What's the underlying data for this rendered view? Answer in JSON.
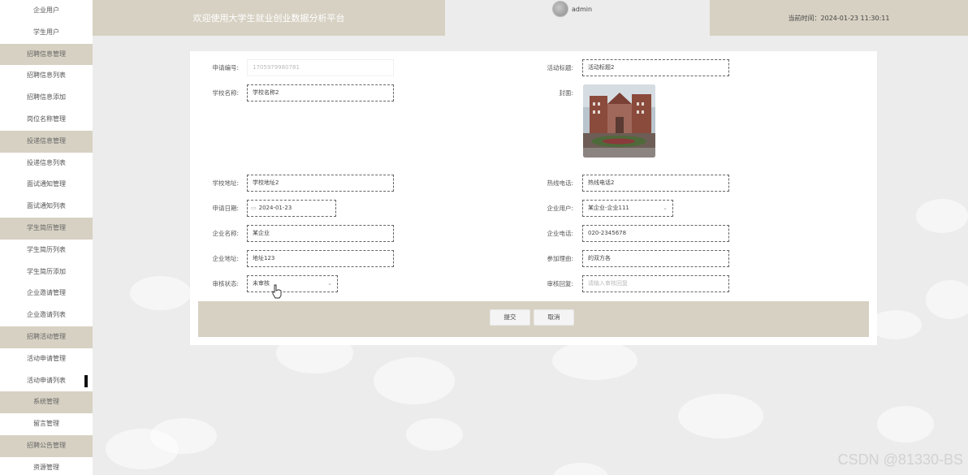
{
  "sidebar": {
    "items": [
      {
        "label": "企业用户",
        "group": false
      },
      {
        "label": "学生用户",
        "group": false
      },
      {
        "label": "招聘信息管理",
        "group": true
      },
      {
        "label": "招聘信息列表",
        "group": false
      },
      {
        "label": "招聘信息添加",
        "group": false
      },
      {
        "label": "岗位名称管理",
        "group": false
      },
      {
        "label": "投递信息管理",
        "group": true
      },
      {
        "label": "投递信息列表",
        "group": false
      },
      {
        "label": "面试通知管理",
        "group": false
      },
      {
        "label": "面试通知列表",
        "group": false
      },
      {
        "label": "学生简历管理",
        "group": true
      },
      {
        "label": "学生简历列表",
        "group": false
      },
      {
        "label": "学生简历添加",
        "group": false
      },
      {
        "label": "企业邀请管理",
        "group": false
      },
      {
        "label": "企业邀请列表",
        "group": false
      },
      {
        "label": "招聘活动管理",
        "group": true
      },
      {
        "label": "活动申请管理",
        "group": false
      },
      {
        "label": "活动申请列表",
        "group": false,
        "active": true
      },
      {
        "label": "系统管理",
        "group": true
      },
      {
        "label": "留言管理",
        "group": false
      },
      {
        "label": "招聘公告管理",
        "group": true
      },
      {
        "label": "资源管理",
        "group": false
      }
    ]
  },
  "header": {
    "welcome": "欢迎使用大学生就业创业数据分析平台",
    "username": "admin",
    "time_label": "当前时间：2024-01-23 11:30:11"
  },
  "form": {
    "apply_no": {
      "label": "申请编号:",
      "value": "1705979980781"
    },
    "activity_title": {
      "label": "活动标题:",
      "value": "活动标题2"
    },
    "school_name": {
      "label": "学校名称:",
      "value": "学校名称2"
    },
    "cover": {
      "label": "封面:"
    },
    "school_address": {
      "label": "学校地址:",
      "value": "学校地址2"
    },
    "contact_phone": {
      "label": "热线电话:",
      "value": "热线电话2"
    },
    "apply_date": {
      "label": "申请日期:",
      "value": "2024-01-23"
    },
    "company_user": {
      "label": "企业用户:",
      "value": "某企业-企业111"
    },
    "company_name": {
      "label": "企业名称:",
      "value": "某企业"
    },
    "company_phone": {
      "label": "企业电话:",
      "value": "020-2345678"
    },
    "company_address": {
      "label": "企业地址:",
      "value": "地址123"
    },
    "join_reason": {
      "label": "参加理由:",
      "value": "的双方各"
    },
    "review_status": {
      "label": "审核状态:",
      "value": "未审核"
    },
    "review_reply": {
      "label": "审核回复:",
      "placeholder": "请输入审核回复"
    }
  },
  "buttons": {
    "submit": "提交",
    "cancel": "取消"
  },
  "watermark": "CSDN @81330-BS",
  "colors": {
    "accent": "#d7d1c3",
    "background": "#ececec"
  }
}
